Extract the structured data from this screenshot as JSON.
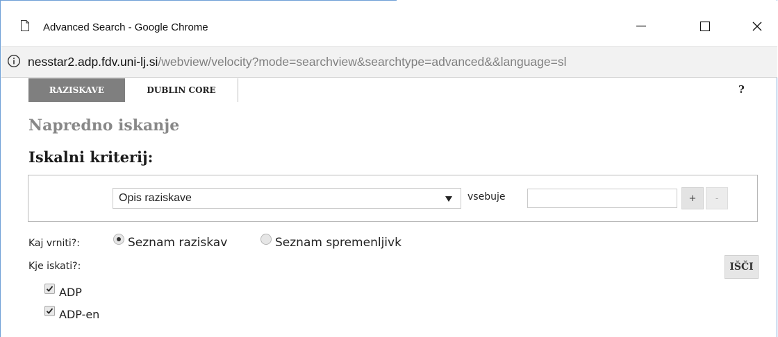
{
  "window": {
    "title": "Advanced Search - Google Chrome",
    "minimize": "—",
    "maximize": "☐",
    "close": "✕"
  },
  "address": {
    "host": "nesstar2.adp.fdv.uni-lj.si",
    "path": "/webview/velocity?mode=searchview&searchtype=advanced&&language=sl"
  },
  "tabs": [
    {
      "label": "RAZISKAVE",
      "active": true
    },
    {
      "label": "DUBLIN CORE",
      "active": false
    }
  ],
  "help_label": "?",
  "page_heading": "Napredno iskanje",
  "criteria_heading": "Iskalni kriterij:",
  "criteria": {
    "field_selected": "Opis raziskave",
    "operator_label": "vsebuje",
    "query_value": "",
    "add_label": "+",
    "remove_label": "-"
  },
  "return_options": {
    "label": "Kaj vrniti?:",
    "options": [
      {
        "label": "Seznam raziskav",
        "checked": true
      },
      {
        "label": "Seznam spremenljivk",
        "checked": false
      }
    ]
  },
  "where": {
    "label": "Kje iskati?:",
    "catalogs": [
      {
        "label": "ADP",
        "checked": true
      },
      {
        "label": "ADP-en",
        "checked": true
      }
    ]
  },
  "search_button_label": "IŠČI",
  "colors": {
    "active_tab_bg": "#7f7f7f",
    "heading_gray": "#888888",
    "window_border": "#6fa0d6"
  }
}
